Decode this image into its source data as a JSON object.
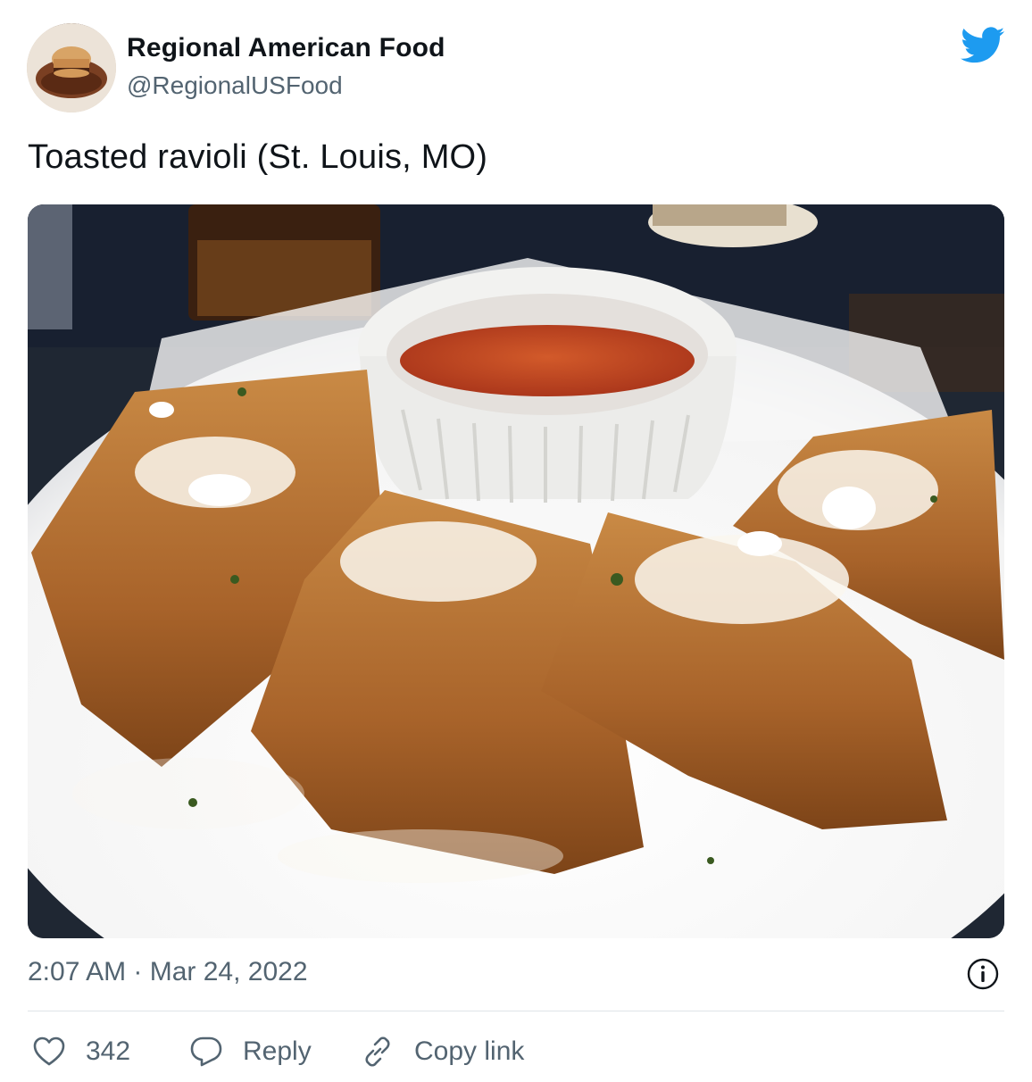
{
  "author": {
    "name": "Regional American Food",
    "handle": "@RegionalUSFood",
    "avatar_icon": "avatar-photo"
  },
  "brand": {
    "icon": "twitter-bird-icon",
    "color": "#1d9bf0"
  },
  "tweet": {
    "text": "Toasted ravioli (St. Louis, MO)",
    "image_icon": "food-photo",
    "timestamp": "2:07 AM · Mar 24, 2022"
  },
  "actions": {
    "likes_count": "342",
    "reply_label": "Reply",
    "copy_link_label": "Copy link"
  },
  "colors": {
    "text": "#0f1419",
    "secondary": "#536471",
    "divider": "#dfe4e8"
  }
}
